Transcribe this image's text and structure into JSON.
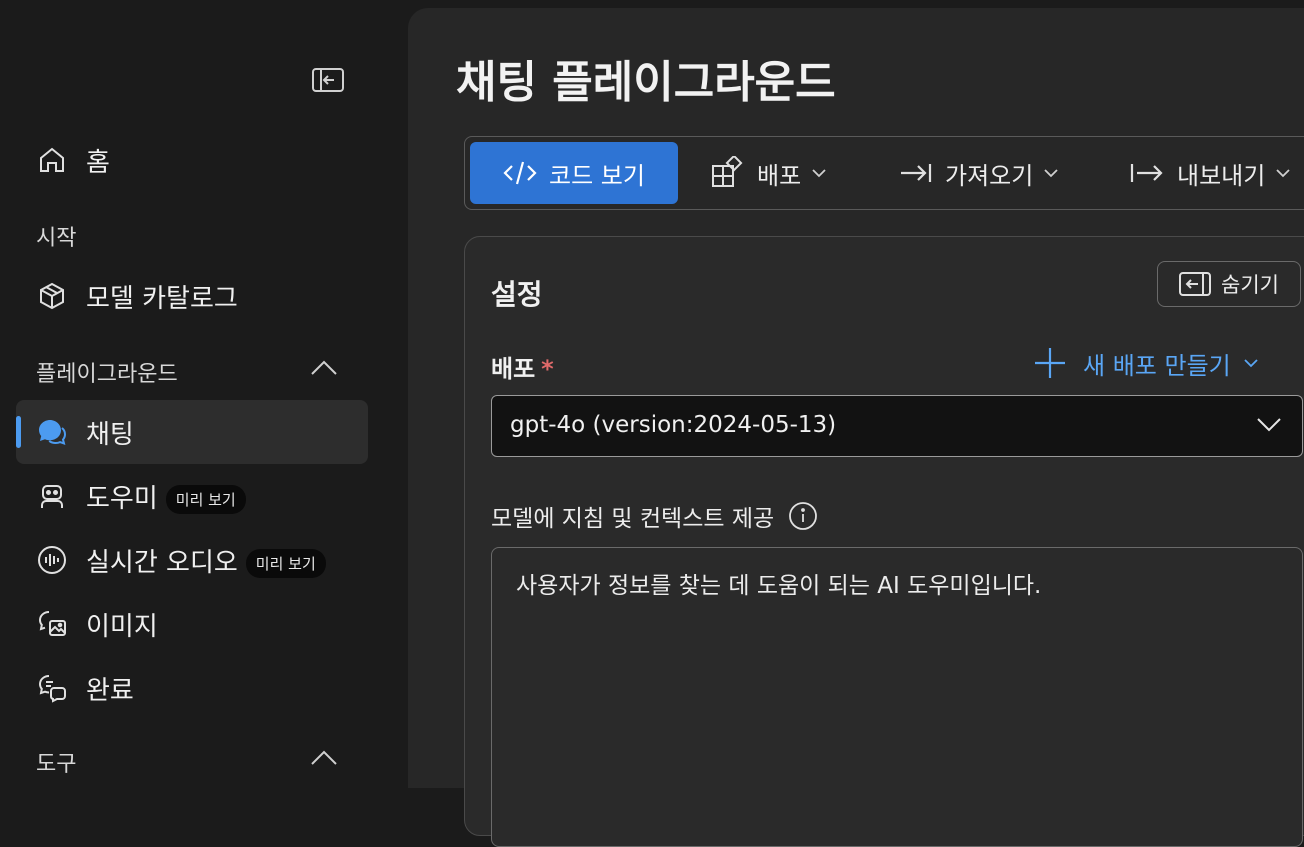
{
  "sidebar": {
    "home": "홈",
    "section_start": "시작",
    "model_catalog": "모델 카탈로그",
    "section_playground": "플레이그라운드",
    "items": [
      {
        "label": "채팅",
        "badge": ""
      },
      {
        "label": "도우미",
        "badge": "미리 보기"
      },
      {
        "label": "실시간 오디오",
        "badge": "미리 보기"
      },
      {
        "label": "이미지",
        "badge": ""
      },
      {
        "label": "완료",
        "badge": ""
      }
    ],
    "section_tools": "도구"
  },
  "main": {
    "title": "채팅 플레이그라운드",
    "toolbar": {
      "view_code": "코드 보기",
      "deploy": "배포",
      "import": "가져오기",
      "export": "내보내기"
    },
    "settings": {
      "title": "설정",
      "hide": "숨기기",
      "deployment_label": "배포",
      "required_mark": "*",
      "new_deployment": "새 배포 만들기",
      "deployment_value": "gpt-4o (version:2024-05-13)",
      "instructions_label": "모델에 지침 및 컨텍스트 제공",
      "instructions_value": "사용자가 정보를 찾는 데 도움이 되는 AI 도우미입니다."
    }
  },
  "colors": {
    "accent": "#2e74d4",
    "link": "#5aa6f5",
    "active_indicator": "#4c9bf0",
    "required": "#e06a6a"
  },
  "icons": [
    "panel-collapse-icon",
    "home-icon",
    "cube-icon",
    "chevron-up-icon",
    "chat-icon",
    "bot-icon",
    "audio-icon",
    "image-icon",
    "completion-icon",
    "code-icon",
    "apps-icon",
    "import-icon",
    "export-icon",
    "chevron-down-icon",
    "hide-panel-icon",
    "plus-icon",
    "info-icon"
  ]
}
